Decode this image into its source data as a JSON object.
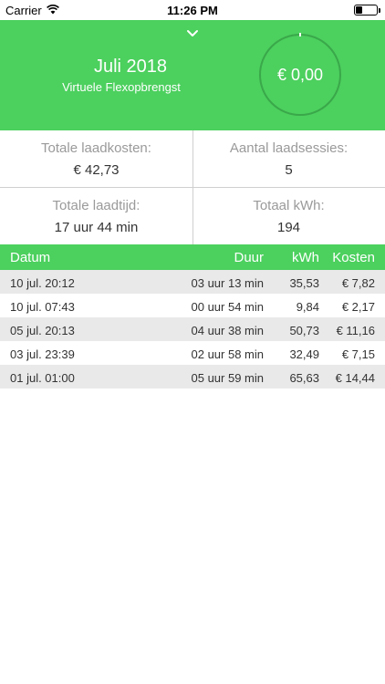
{
  "status_bar": {
    "carrier": "Carrier",
    "time": "11:26 PM"
  },
  "header": {
    "month": "Juli 2018",
    "subtitle": "Virtuele Flexopbrengst",
    "amount": "€ 0,00",
    "accent_color": "#4cd05e",
    "expand_icon": "chevron-down-icon"
  },
  "stats": {
    "total_cost_label": "Totale laadkosten:",
    "total_cost_value": "€ 42,73",
    "sessions_label": "Aantal laadsessies:",
    "sessions_value": "5",
    "charge_time_label": "Totale laadtijd:",
    "charge_time_value": "17 uur  44 min",
    "kwh_label": "Totaal kWh:",
    "kwh_value": "194"
  },
  "table": {
    "headers": {
      "date": "Datum",
      "duration": "Duur",
      "kwh": "kWh",
      "cost": "Kosten"
    },
    "rows": [
      {
        "date": "10 jul. 20:12",
        "duration": "03 uur  13 min",
        "kwh": "35,53",
        "cost": "€ 7,82"
      },
      {
        "date": "10 jul. 07:43",
        "duration": "00 uur  54 min",
        "kwh": "9,84",
        "cost": "€ 2,17"
      },
      {
        "date": "05 jul. 20:13",
        "duration": "04 uur  38 min",
        "kwh": "50,73",
        "cost": "€ 11,16"
      },
      {
        "date": "03 jul. 23:39",
        "duration": "02 uur  58 min",
        "kwh": "32,49",
        "cost": "€ 7,15"
      },
      {
        "date": "01 jul. 01:00",
        "duration": "05 uur  59 min",
        "kwh": "65,63",
        "cost": "€ 14,44"
      }
    ]
  }
}
